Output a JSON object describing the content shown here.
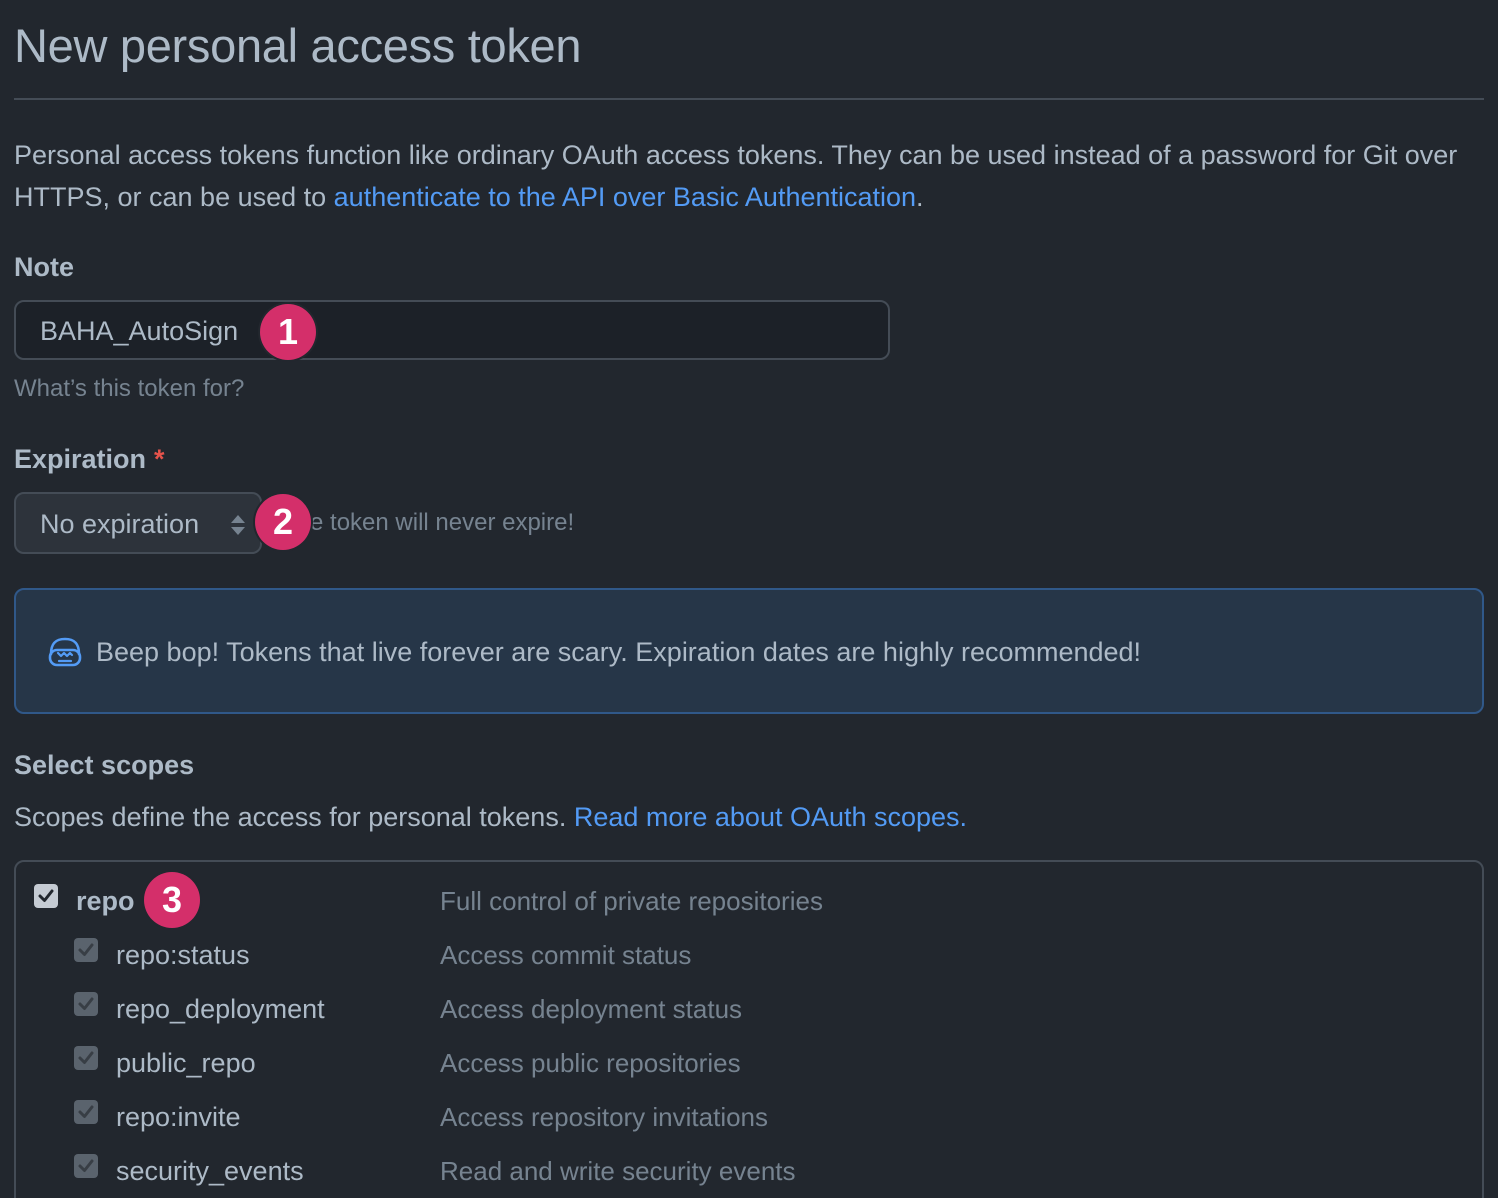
{
  "page": {
    "title": "New personal access token"
  },
  "intro": {
    "text_before": "Personal access tokens function like ordinary OAuth access tokens. They can be used instead of a password for Git over HTTPS, or can be used to ",
    "link": "authenticate to the API over Basic Authentication",
    "text_after": "."
  },
  "note": {
    "label": "Note",
    "value": "BAHA_AutoSign",
    "hint": "What’s this token for?"
  },
  "expiration": {
    "label": "Expiration",
    "required_mark": "*",
    "selected": "No expiration",
    "note": "The token will never expire!"
  },
  "warning": {
    "icon": "copilot-icon",
    "text": "Beep bop! Tokens that live forever are scary. Expiration dates are highly recommended!"
  },
  "scopes": {
    "heading": "Select scopes",
    "description": "Scopes define the access for personal tokens. ",
    "link": "Read more about OAuth scopes.",
    "items": [
      {
        "name": "repo",
        "description": "Full control of private repositories",
        "checked": true
      },
      {
        "name": "repo:status",
        "description": "Access commit status",
        "checked": true
      },
      {
        "name": "repo_deployment",
        "description": "Access deployment status",
        "checked": true
      },
      {
        "name": "public_repo",
        "description": "Access public repositories",
        "checked": true
      },
      {
        "name": "repo:invite",
        "description": "Access repository invitations",
        "checked": true
      },
      {
        "name": "security_events",
        "description": "Read and write security events",
        "checked": true
      }
    ]
  },
  "badges": [
    "1",
    "2",
    "3"
  ],
  "colors": {
    "background": "#22272e",
    "link": "#539bf5",
    "badge": "#d42f6a",
    "required": "#e5534b",
    "flash_border": "#305889"
  }
}
